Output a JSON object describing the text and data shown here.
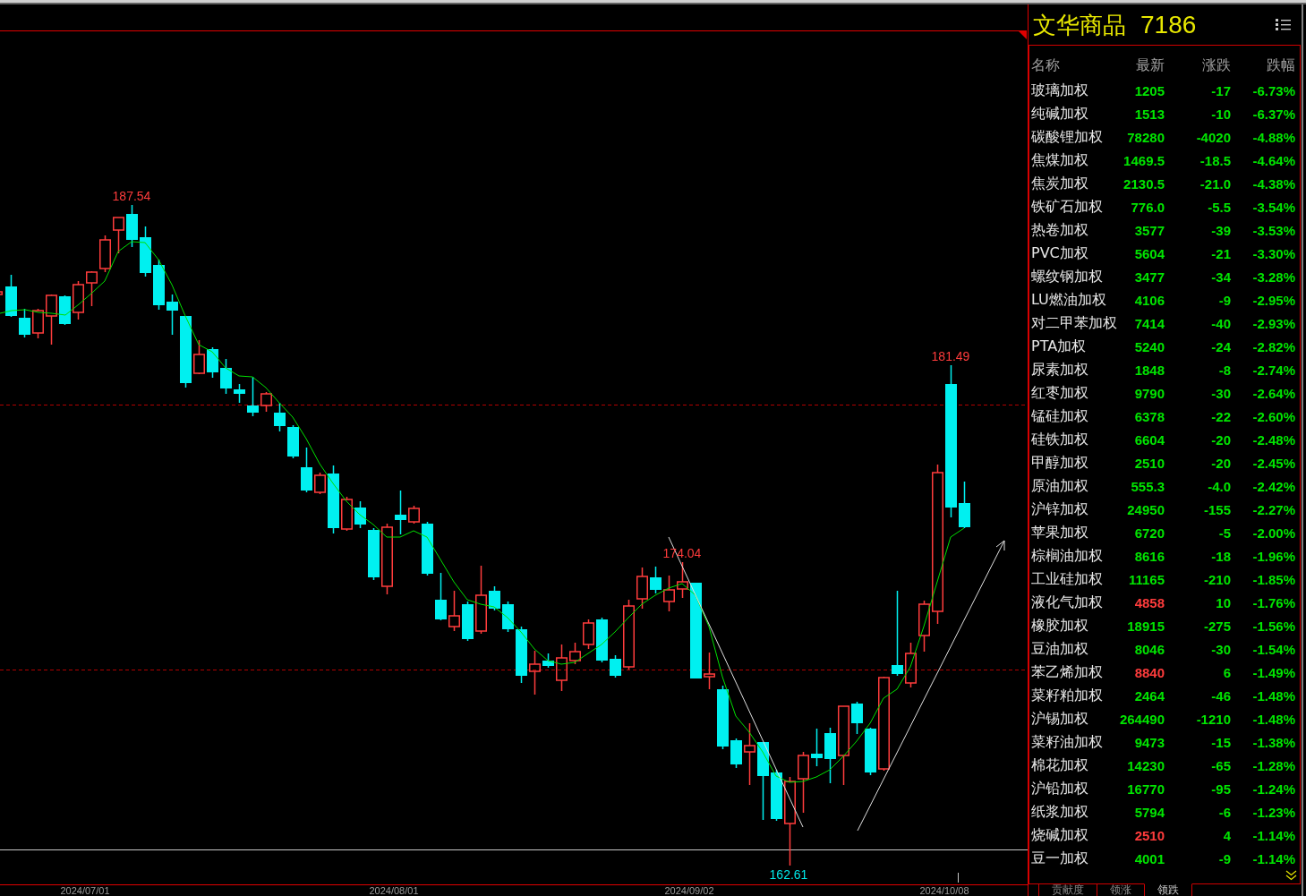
{
  "chart": {
    "extreme_labels": [
      {
        "text": "187.54",
        "kind": "high"
      },
      {
        "text": "181.49",
        "kind": "high"
      },
      {
        "text": "174.04",
        "kind": "high"
      },
      {
        "text": "162.61",
        "kind": "low"
      }
    ],
    "dates": [
      "2024/07/01",
      "2024/08/01",
      "2024/09/02",
      "2024/10/08"
    ]
  },
  "panel": {
    "title": "文华商品",
    "count": "7186",
    "columns": [
      "名称",
      "最新",
      "涨跌",
      "跌幅"
    ],
    "rows": [
      {
        "name": "玻璃加权",
        "latest": "1205",
        "change": "-17",
        "pct": "-6.73%",
        "color": "#00e600"
      },
      {
        "name": "纯碱加权",
        "latest": "1513",
        "change": "-10",
        "pct": "-6.37%",
        "color": "#00e600"
      },
      {
        "name": "碳酸锂加权",
        "latest": "78280",
        "change": "-4020",
        "pct": "-4.88%",
        "color": "#00e600"
      },
      {
        "name": "焦煤加权",
        "latest": "1469.5",
        "change": "-18.5",
        "pct": "-4.64%",
        "color": "#00e600"
      },
      {
        "name": "焦炭加权",
        "latest": "2130.5",
        "change": "-21.0",
        "pct": "-4.38%",
        "color": "#00e600"
      },
      {
        "name": "铁矿石加权",
        "latest": "776.0",
        "change": "-5.5",
        "pct": "-3.54%",
        "color": "#00e600"
      },
      {
        "name": "热卷加权",
        "latest": "3577",
        "change": "-39",
        "pct": "-3.53%",
        "color": "#00e600"
      },
      {
        "name": "PVC加权",
        "latest": "5604",
        "change": "-21",
        "pct": "-3.30%",
        "color": "#00e600"
      },
      {
        "name": "螺纹钢加权",
        "latest": "3477",
        "change": "-34",
        "pct": "-3.28%",
        "color": "#00e600"
      },
      {
        "name": "LU燃油加权",
        "latest": "4106",
        "change": "-9",
        "pct": "-2.95%",
        "color": "#00e600"
      },
      {
        "name": "对二甲苯加权",
        "latest": "7414",
        "change": "-40",
        "pct": "-2.93%",
        "color": "#00e600"
      },
      {
        "name": "PTA加权",
        "latest": "5240",
        "change": "-24",
        "pct": "-2.82%",
        "color": "#00e600"
      },
      {
        "name": "尿素加权",
        "latest": "1848",
        "change": "-8",
        "pct": "-2.74%",
        "color": "#00e600"
      },
      {
        "name": "红枣加权",
        "latest": "9790",
        "change": "-30",
        "pct": "-2.64%",
        "color": "#00e600"
      },
      {
        "name": "锰硅加权",
        "latest": "6378",
        "change": "-22",
        "pct": "-2.60%",
        "color": "#00e600"
      },
      {
        "name": "硅铁加权",
        "latest": "6604",
        "change": "-20",
        "pct": "-2.48%",
        "color": "#00e600"
      },
      {
        "name": "甲醇加权",
        "latest": "2510",
        "change": "-20",
        "pct": "-2.45%",
        "color": "#00e600"
      },
      {
        "name": "原油加权",
        "latest": "555.3",
        "change": "-4.0",
        "pct": "-2.42%",
        "color": "#00e600"
      },
      {
        "name": "沪锌加权",
        "latest": "24950",
        "change": "-155",
        "pct": "-2.27%",
        "color": "#00e600"
      },
      {
        "name": "苹果加权",
        "latest": "6720",
        "change": "-5",
        "pct": "-2.00%",
        "color": "#00e600"
      },
      {
        "name": "棕榈油加权",
        "latest": "8616",
        "change": "-18",
        "pct": "-1.96%",
        "color": "#00e600"
      },
      {
        "name": "工业硅加权",
        "latest": "11165",
        "change": "-210",
        "pct": "-1.85%",
        "color": "#00e600"
      },
      {
        "name": "液化气加权",
        "latest": "4858",
        "change": "10",
        "pct": "-1.76%",
        "color": "#ff3c3c"
      },
      {
        "name": "橡胶加权",
        "latest": "18915",
        "change": "-275",
        "pct": "-1.56%",
        "color": "#00e600"
      },
      {
        "name": "豆油加权",
        "latest": "8046",
        "change": "-30",
        "pct": "-1.54%",
        "color": "#00e600"
      },
      {
        "name": "苯乙烯加权",
        "latest": "8840",
        "change": "6",
        "pct": "-1.49%",
        "color": "#ff3c3c"
      },
      {
        "name": "菜籽粕加权",
        "latest": "2464",
        "change": "-46",
        "pct": "-1.48%",
        "color": "#00e600"
      },
      {
        "name": "沪锡加权",
        "latest": "264490",
        "change": "-1210",
        "pct": "-1.48%",
        "color": "#00e600"
      },
      {
        "name": "菜籽油加权",
        "latest": "9473",
        "change": "-15",
        "pct": "-1.38%",
        "color": "#00e600"
      },
      {
        "name": "棉花加权",
        "latest": "14230",
        "change": "-65",
        "pct": "-1.28%",
        "color": "#00e600"
      },
      {
        "name": "沪铅加权",
        "latest": "16770",
        "change": "-95",
        "pct": "-1.24%",
        "color": "#00e600"
      },
      {
        "name": "纸浆加权",
        "latest": "5794",
        "change": "-6",
        "pct": "-1.23%",
        "color": "#00e600"
      },
      {
        "name": "烧碱加权",
        "latest": "2510",
        "change": "4",
        "pct": "-1.14%",
        "color": "#ff3c3c"
      },
      {
        "name": "豆一加权",
        "latest": "4001",
        "change": "-9",
        "pct": "-1.14%",
        "color": "#00e600"
      }
    ],
    "tabs": [
      {
        "label": "贡献度",
        "selected": false
      },
      {
        "label": "领涨",
        "selected": false
      },
      {
        "label": "领跌",
        "selected": true
      }
    ]
  }
}
